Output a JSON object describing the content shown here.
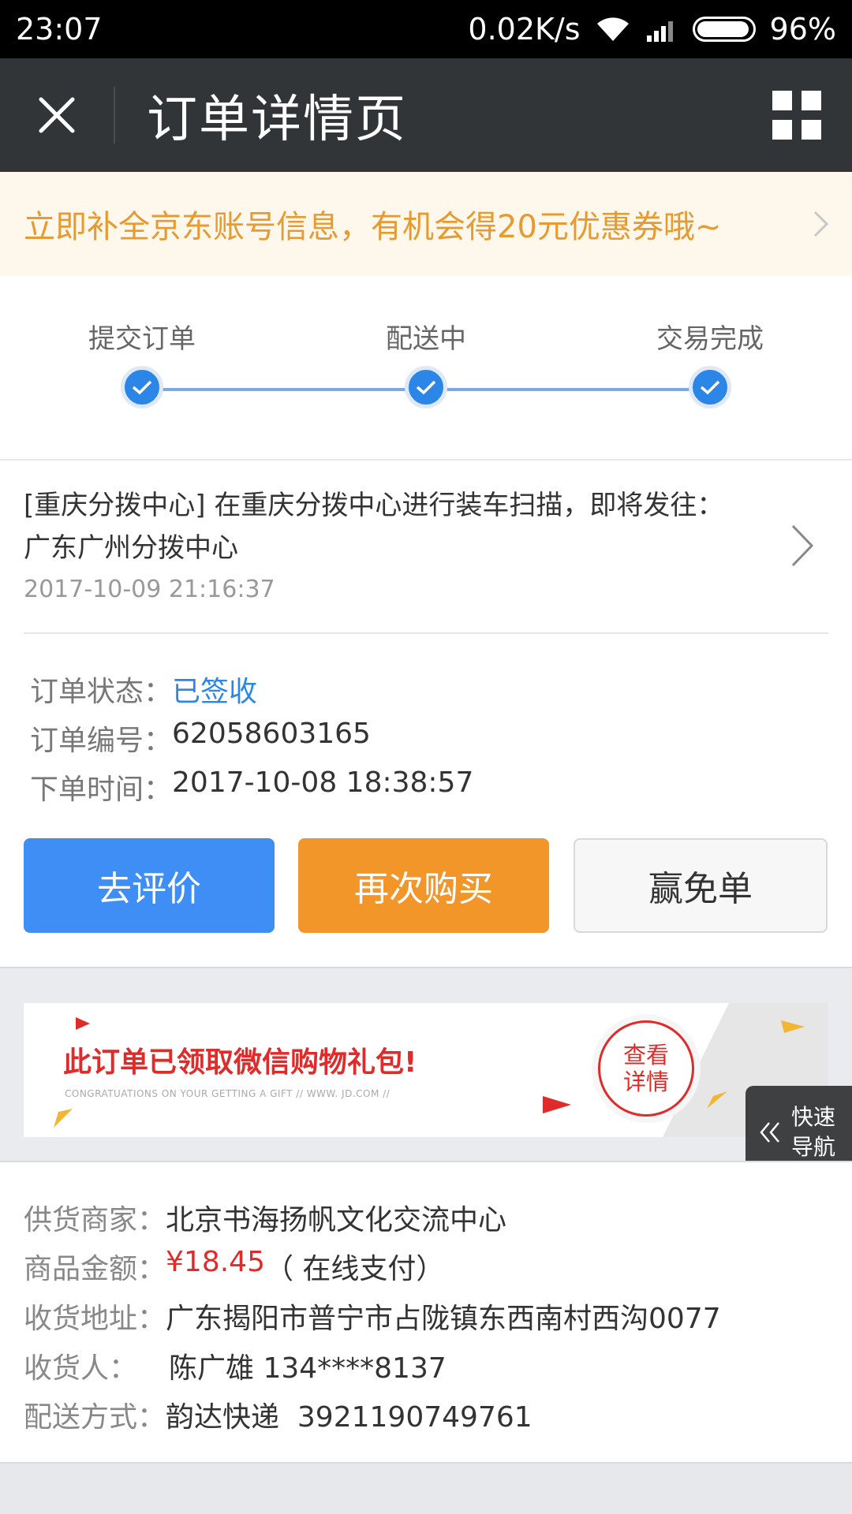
{
  "status_bar": {
    "time": "23:07",
    "speed": "0.02K/s",
    "battery": "96%"
  },
  "header": {
    "title": "订单详情页"
  },
  "promo": {
    "text": "立即补全京东账号信息，有机会得20元优惠券哦~"
  },
  "steps": [
    "提交订单",
    "配送中",
    "交易完成"
  ],
  "logistics": {
    "line1": "[重庆分拨中心] 在重庆分拨中心进行装车扫描，即将发往：",
    "line2": "广东广州分拨中心",
    "time": "2017-10-09 21:16:37"
  },
  "order": {
    "status_label": "订单状态：",
    "status_value": "已签收",
    "number_label": "订单编号：",
    "number_value": "62058603165",
    "time_label": "下单时间：",
    "time_value": "2017-10-08 18:38:57"
  },
  "actions": {
    "review": "去评价",
    "rebuy": "再次购买",
    "free": "赢免单"
  },
  "gift": {
    "title": "此订单已领取微信购物礼包!",
    "subtitle": "CONGRATUATIONS ON YOUR GETTING A GIFT // WWW. JD.COM //",
    "badge_line1": "查看",
    "badge_line2": "详情"
  },
  "quick_nav": {
    "line1": "快速",
    "line2": "导航"
  },
  "details": {
    "merchant_label": "供货商家：",
    "merchant_value": "北京书海扬帆文化交流中心",
    "amount_label": "商品金额：",
    "amount_value": "¥18.45",
    "amount_note": "（ 在线支付）",
    "address_label": "收货地址：",
    "address_value": "广东揭阳市普宁市占陇镇东西南村西沟0077",
    "receiver_label": "收货人：",
    "receiver_value": "陈广雄 134****8137",
    "delivery_label": "配送方式：",
    "delivery_value": "韵达快递  3921190749761"
  },
  "colors": {
    "header_bg": "#323537",
    "primary_blue": "#3f8ef5",
    "orange": "#f2962a",
    "price_red": "#e02b2b",
    "promo_text": "#e79a2f"
  }
}
